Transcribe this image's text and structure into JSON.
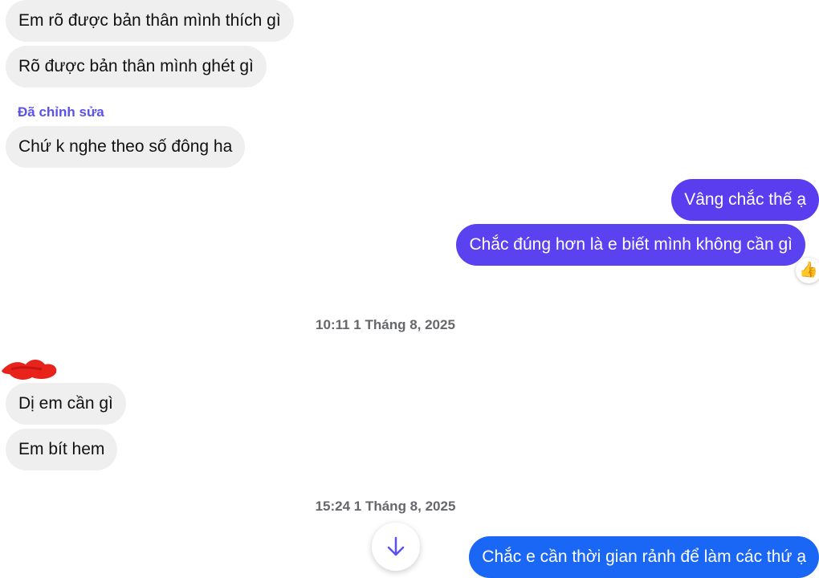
{
  "received_group_1": [
    "Em rõ được bản thân mình thích gì",
    "Rõ được bản thân mình ghét gì"
  ],
  "edited_label": "Đã chỉnh sửa",
  "received_edited": "Chứ k nghe theo số đông ha",
  "sent_group_1": [
    "Vâng chắc thế ạ",
    "Chắc đúng hơn là e biết mình không cần gì"
  ],
  "reaction_emoji": "👍",
  "timestamp_1": "10:11 1 Tháng 8, 2025",
  "received_group_2": [
    "Dị em cần gì",
    "Em bít hem"
  ],
  "timestamp_2": "15:24 1 Tháng 8, 2025",
  "sent_last": "Chắc e cần thời gian rảnh để làm các thứ ạ",
  "colors": {
    "received_bg": "#efefef",
    "sent_purple": "#5b3df0",
    "sent_purple_2": "#5a42f0",
    "sent_blue": "#1a66f5",
    "edited_label": "#5b51ef",
    "timestamp": "#65676b",
    "redaction": "#e8231c"
  },
  "icons": {
    "scroll_down": "arrow-down-icon",
    "redaction": "red-scribble-avatar-redaction"
  }
}
